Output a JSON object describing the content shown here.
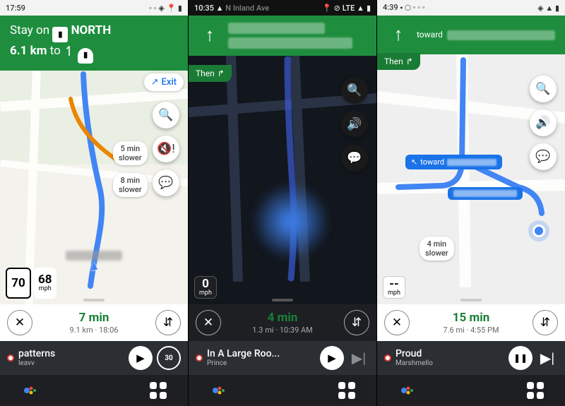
{
  "panel1": {
    "status_time": "17:59",
    "banner_text1": "Stay on",
    "banner_shield1": "🛡",
    "banner_dir": "NORTH",
    "banner_dist": "6.1 km",
    "banner_to": "to",
    "exit_label": "Exit",
    "traffic1": "5 min\nslower",
    "traffic2": "8 min\nslower",
    "speed_limit": "70",
    "speed_current": "68",
    "speed_unit": "mph",
    "eta_big": "7 min",
    "eta_small": "9.1 km  ·  18:06",
    "media_title": "patterns",
    "media_artist": "leavv",
    "icons": {
      "search": "🔍",
      "sound": "🔇!",
      "add": "💬",
      "close": "✕",
      "route": "⇵",
      "play": "▶",
      "fwd30": "↻"
    }
  },
  "panel2": {
    "status_time": "10:35",
    "status_extra": "LTE ▲",
    "then_label": "Then",
    "speed_current": "0",
    "speed_unit": "mph",
    "eta_big": "4 min",
    "eta_small": "1.3 mi  ·  10:39 AM",
    "media_title": "In A Large Roo...",
    "media_artist": "Prince",
    "icons": {
      "search": "🔍",
      "sound": "🔊",
      "add": "💬",
      "close": "✕",
      "route": "⇵",
      "play": "▶",
      "next": "▶|"
    }
  },
  "panel3": {
    "status_time": "4:39",
    "banner_toward": "toward",
    "then_label": "Then",
    "route_chip1": "toward",
    "traffic1": "4 min\nslower",
    "speed_current": "--",
    "speed_unit": "mph",
    "eta_big": "15 min",
    "eta_small": "7.6 mi  ·  4:55 PM",
    "media_title": "Proud",
    "media_artist": "Marshmello",
    "icons": {
      "search": "🔍",
      "sound": "🔊",
      "add": "💬",
      "close": "✕",
      "route": "⇵",
      "pause": "❚❚",
      "next": "▶|"
    }
  }
}
